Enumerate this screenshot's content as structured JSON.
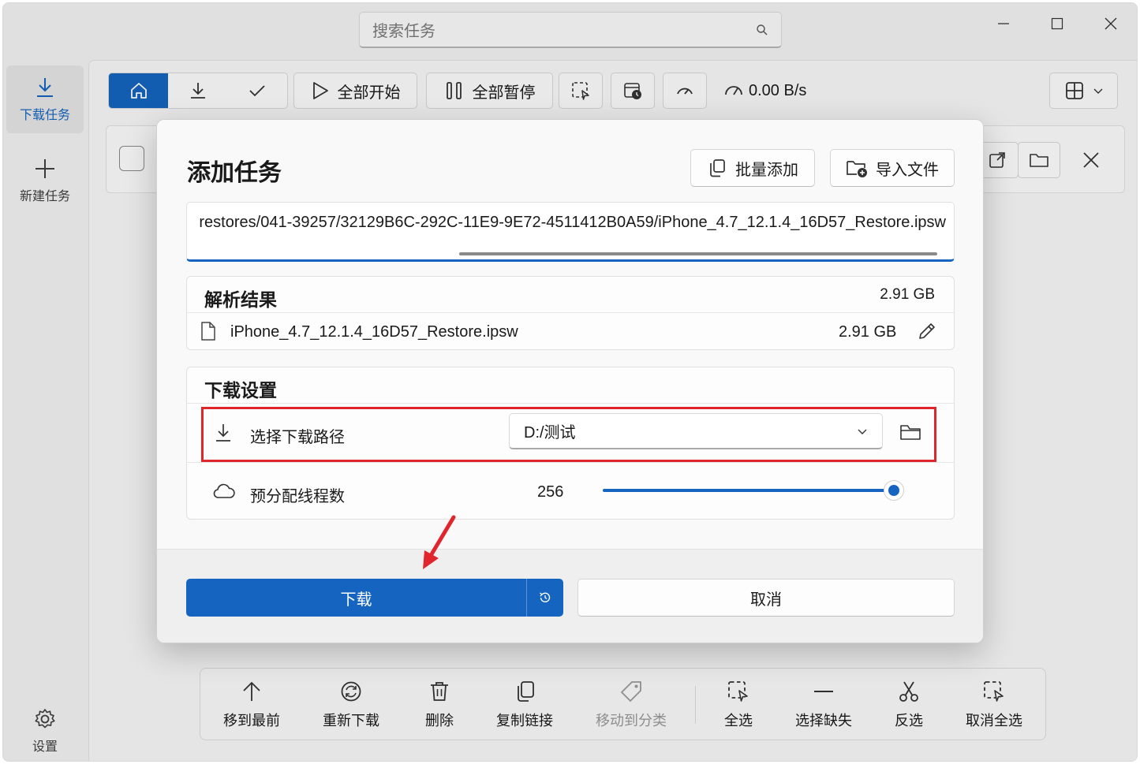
{
  "titlebar": {
    "search_placeholder": "搜索任务",
    "icons": [
      "search-icon",
      "minimize-icon",
      "maximize-icon",
      "close-icon"
    ]
  },
  "sidebar": {
    "items": [
      {
        "label": "下载任务",
        "icon": "download-icon",
        "active": true
      },
      {
        "label": "新建任务",
        "icon": "plus-icon",
        "active": false
      }
    ],
    "settings_label": "设置"
  },
  "toolbar": {
    "start_all": "全部开始",
    "pause_all": "全部暂停",
    "speed": "0.00 B/s"
  },
  "bottom_bar": {
    "items": [
      {
        "label": "移到最前",
        "icon": "arrow-up-icon",
        "enabled": true
      },
      {
        "label": "重新下载",
        "icon": "refresh-icon",
        "enabled": true
      },
      {
        "label": "删除",
        "icon": "trash-icon",
        "enabled": true
      },
      {
        "label": "复制链接",
        "icon": "copy-icon",
        "enabled": true
      },
      {
        "label": "移动到分类",
        "icon": "tag-icon",
        "enabled": false
      },
      {
        "label": "全选",
        "icon": "select-all-icon",
        "enabled": true
      },
      {
        "label": "选择缺失",
        "icon": "minus-icon",
        "enabled": true
      },
      {
        "label": "反选",
        "icon": "scissors-icon",
        "enabled": true
      },
      {
        "label": "取消全选",
        "icon": "deselect-icon",
        "enabled": true
      }
    ]
  },
  "dialog": {
    "title": "添加任务",
    "batch_add": "批量添加",
    "import_file": "导入文件",
    "url": "restores/041-39257/32129B6C-292C-11E9-9E72-4511412B0A59/iPhone_4.7_12.1.4_16D57_Restore.ipsw",
    "parse_result": {
      "title": "解析结果",
      "total_size": "2.91 GB",
      "file_name": "iPhone_4.7_12.1.4_16D57_Restore.ipsw",
      "file_size": "2.91 GB"
    },
    "download_settings": {
      "title": "下载设置",
      "path_label": "选择下载路径",
      "path_value": "D:/测试",
      "threads_label": "预分配线程数",
      "threads_value": "256",
      "threads_fraction": 1.0
    },
    "download_button": "下载",
    "cancel_button": "取消"
  },
  "colors": {
    "accent": "#1565c0",
    "highlight": "#e0252d"
  }
}
